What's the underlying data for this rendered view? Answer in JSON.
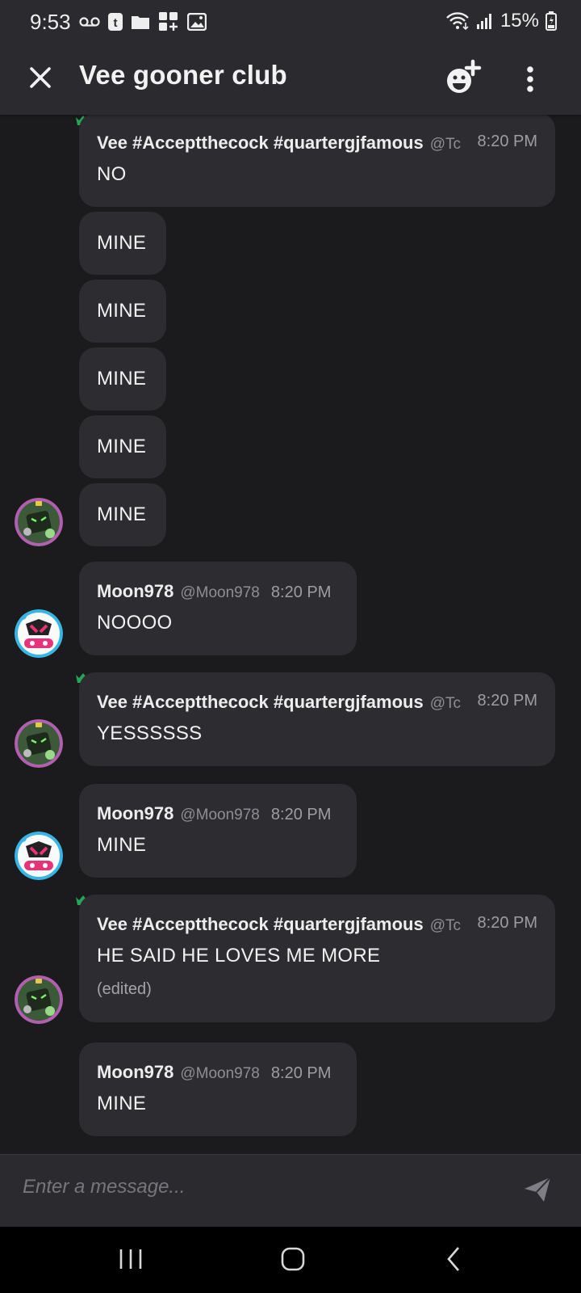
{
  "status_bar": {
    "time": "9:53",
    "battery": "15%"
  },
  "header": {
    "title": "Vee gooner club"
  },
  "messages": [
    {
      "name": "Vee #Acceptthecock #quartergjfamous",
      "handle": "@Tc",
      "time": "8:20 PM",
      "text": "NO"
    },
    {
      "text": "MINE"
    },
    {
      "text": "MINE"
    },
    {
      "text": "MINE"
    },
    {
      "text": "MINE"
    },
    {
      "text": "MINE"
    },
    {
      "name": "Moon978",
      "handle": "@Moon978",
      "time": "8:20 PM",
      "text": "NOOOO"
    },
    {
      "name": "Vee #Acceptthecock #quartergjfamous",
      "handle": "@Tc",
      "time": "8:20 PM",
      "text": "YESSSSSS"
    },
    {
      "name": "Moon978",
      "handle": "@Moon978",
      "time": "8:20 PM",
      "text": "MINE"
    },
    {
      "name": "Vee #Acceptthecock #quartergjfamous",
      "handle": "@Tc",
      "time": "8:20 PM",
      "text": "HE SAID HE LOVES ME MORE",
      "edited": "(edited)"
    },
    {
      "name": "Moon978",
      "handle": "@Moon978",
      "time": "8:20 PM",
      "text": "MINE"
    }
  ],
  "composer": {
    "placeholder": "Enter a message..."
  },
  "icons": {
    "close": "close-icon",
    "emoji_add": "add-emoji-icon",
    "more": "more-vert-icon",
    "send": "send-icon",
    "crown": "crown-icon",
    "recents": "recents-icon",
    "home": "home-icon",
    "back": "back-icon"
  },
  "colors": {
    "crown": "#23a55a",
    "vee_ring": "#b35fb0",
    "moon_ring": "#36b6e6"
  }
}
